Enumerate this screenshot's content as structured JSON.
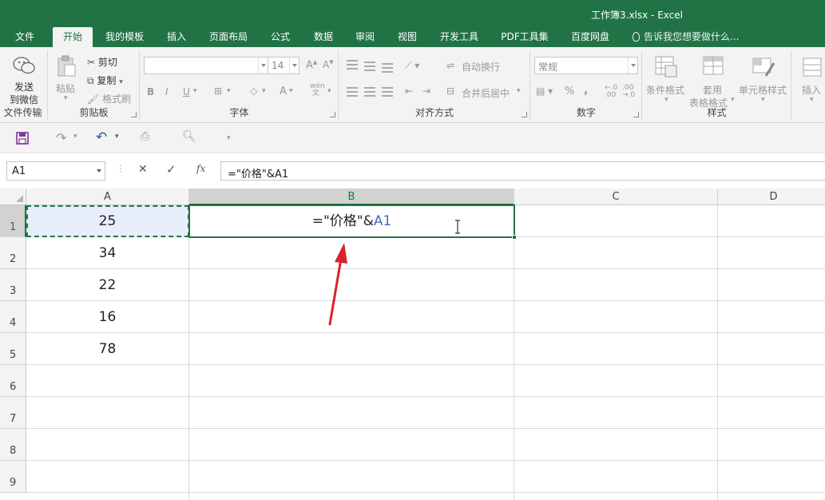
{
  "window": {
    "title": "工作簿3.xlsx - Excel"
  },
  "tabs": [
    {
      "label": "文件",
      "left": 0
    },
    {
      "label": "开始",
      "active": true
    },
    {
      "label": "我的模板"
    },
    {
      "label": "插入"
    },
    {
      "label": "页面布局"
    },
    {
      "label": "公式"
    },
    {
      "label": "数据"
    },
    {
      "label": "审阅"
    },
    {
      "label": "视图"
    },
    {
      "label": "开发工具"
    },
    {
      "label": "PDF工具集"
    },
    {
      "label": "百度网盘"
    }
  ],
  "tell_me": "告诉我您想要做什么...",
  "ribbon": {
    "file_transfer": {
      "button_line1": "发送",
      "button_line2": "到微信",
      "label": "文件传输"
    },
    "clipboard": {
      "paste": "粘贴",
      "cut": "剪切",
      "copy": "复制",
      "format_painter": "格式刷",
      "label": "剪贴板"
    },
    "font": {
      "font_name": "",
      "font_size": "14",
      "bold": "B",
      "italic": "I",
      "underline": "U",
      "label": "字体"
    },
    "alignment": {
      "wrap_text": "自动换行",
      "merge_center": "合并后居中",
      "label": "对齐方式"
    },
    "number": {
      "format": "常规",
      "percent": "%",
      "comma": ",",
      "label": "数字"
    },
    "styles": {
      "conditional": "条件格式",
      "table_line1": "套用",
      "table_line2": "表格格式",
      "cell_styles": "单元格样式",
      "label": "样式"
    },
    "cells": {
      "insert": "插入"
    }
  },
  "formula_bar": {
    "name_box": "A1",
    "cancel": "✕",
    "enter": "✓",
    "fx": "fx",
    "formula": "=\"价格\"&A1"
  },
  "sheet": {
    "columns": [
      "A",
      "B",
      "C",
      "D"
    ],
    "rows": [
      "1",
      "2",
      "3",
      "4",
      "5",
      "6",
      "7",
      "8",
      "9"
    ],
    "col_a_values": [
      "25",
      "34",
      "22",
      "16",
      "78"
    ],
    "b1_text": "=\"价格\"&",
    "b1_ref": "A1"
  },
  "colors": {
    "accent": "#217346",
    "arrow": "#d9232d",
    "ref": "#3d6fb6"
  }
}
